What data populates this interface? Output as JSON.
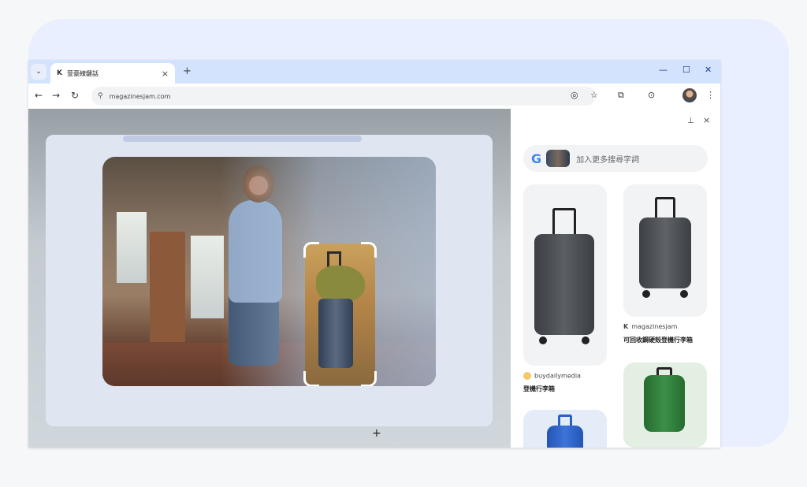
{
  "browser": {
    "tab_title": "萱豪線鍵話",
    "tab_favicon": "K",
    "url": "magazinesjam.com",
    "window_controls": [
      "—",
      "☐",
      "✕"
    ]
  },
  "side_panel": {
    "search_placeholder": "加入更多搜尋字詞",
    "results": [
      {
        "source": "buydailymedia",
        "title": "登機行李箱"
      },
      {
        "source": "magazinesjam",
        "title": "可回收鋼硬殼登機行李箱"
      }
    ]
  },
  "colors": {
    "accent": "#1a73e8",
    "stage_bg": "#e9efff",
    "tabbar": "#d3e3fd",
    "suitcase_gray": "#4a4d52",
    "suitcase_green": "#2f7d3a",
    "suitcase_blue": "#2a5fc4"
  }
}
